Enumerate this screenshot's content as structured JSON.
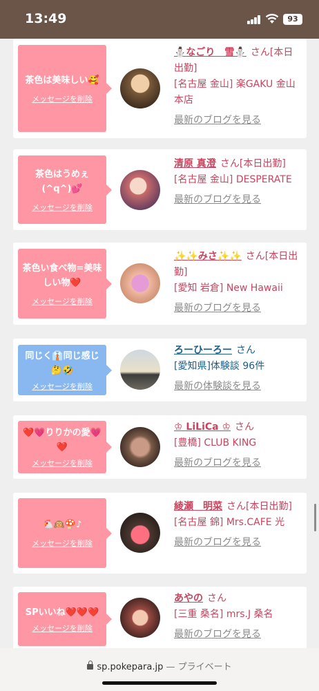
{
  "status_bar": {
    "time": "13:49",
    "battery": "93"
  },
  "items": [
    {
      "message": "茶色は美味しい🥰",
      "delete_label": "メッセージを削除",
      "name": "⛄なごり　雪⛄",
      "san": "さん[本日出勤]",
      "detail": "[名古屋 金山] 楽GAKU 金山本店",
      "blog": "最新のブログを見る",
      "style": "pink"
    },
    {
      "message": "茶色はうめぇ(^q^)💕",
      "delete_label": "メッセージを削除",
      "name": "清原 真澄",
      "san": "さん[本日出勤]",
      "detail": "[名古屋 金山] DESPERATE",
      "blog": "最新のブログを見る",
      "style": "pink"
    },
    {
      "message": "茶色い食べ物=美味しい物❤️",
      "delete_label": "メッセージを削除",
      "name": "✨✨みさ✨✨",
      "san": "さん[本日出勤]",
      "detail": "[愛知 岩倉] New Hawaii",
      "blog": "最新のブログを見る",
      "style": "pink"
    },
    {
      "message": "同じく👔同じ感じ🤔🤣",
      "delete_label": "メッセージを削除",
      "name": "ろーひーろー",
      "san": "さん",
      "detail": "[愛知県]体験談 96件",
      "blog": "最新の体験談を見る",
      "style": "blue"
    },
    {
      "message": "❤️💗りりかの愛💗❤️",
      "delete_label": "メッセージを削除",
      "name": "♔ LiLiCa ♔",
      "san": "さん",
      "detail": "[豊橋] CLUB KING",
      "blog": "最新のブログを見る",
      "style": "pink"
    },
    {
      "message": "🐔🙉🍄♪",
      "delete_label": "メッセージを削除",
      "name": "綾瀬　明菜",
      "san": "さん[本日出勤]",
      "detail": "[名古屋 錦] Mrs.CAFE 光",
      "blog": "最新のブログを見る",
      "style": "pink"
    },
    {
      "message": "SPいいね❤️❤️❤️",
      "delete_label": "メッセージを削除",
      "name": "あやの",
      "san": "さん",
      "detail": "[三重 桑名] mrs.J 桑名",
      "blog": "最新のブログを見る",
      "style": "pink"
    }
  ],
  "url_bar": {
    "domain": "sp.pokepara.jp",
    "separator": " — ",
    "mode": "プライベート"
  },
  "colors": {
    "accent_pink": "#ff96a3",
    "accent_blue": "#89b7f0",
    "name_pink": "#c8445f",
    "name_blue": "#1a5e8e",
    "status_bar": "#6b5448"
  }
}
